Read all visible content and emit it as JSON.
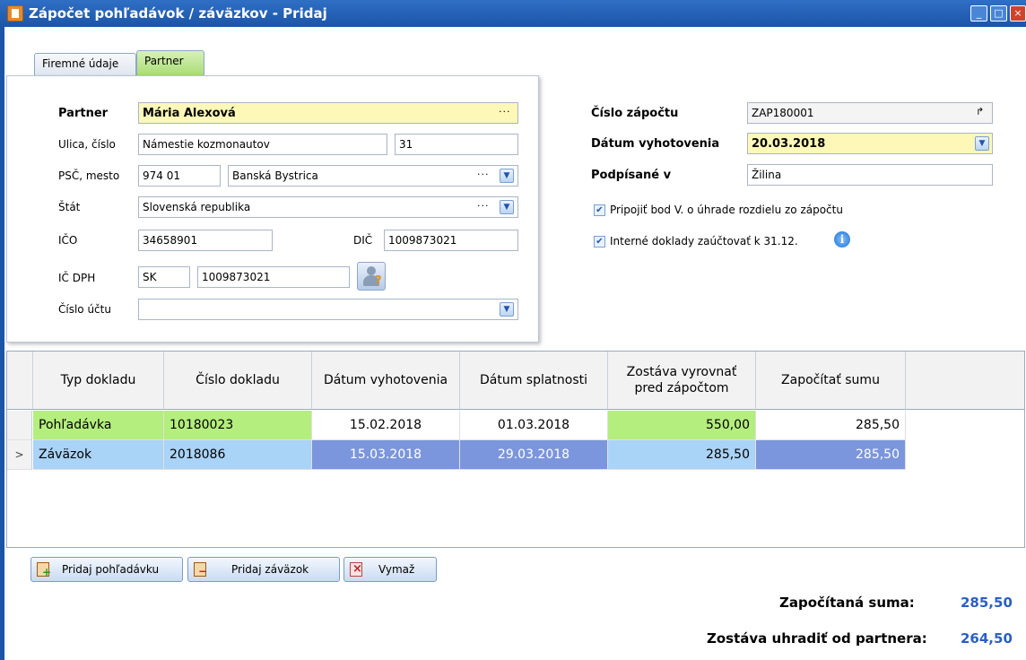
{
  "window": {
    "title": "Zápočet pohľadávok / záväzkov - Pridaj"
  },
  "tabs": [
    {
      "label": "Firemné údaje"
    },
    {
      "label": "Partner"
    }
  ],
  "partner": {
    "partner_label": "Partner",
    "partner_value": "Mária Alexová",
    "street_label": "Ulica, číslo",
    "street_value": "Námestie kozmonautov",
    "number_value": "31",
    "city_label": "PSČ, mesto",
    "zip_value": "974 01",
    "city_value": "Banská Bystrica",
    "country_label": "Štát",
    "country_value": "Slovenská republika",
    "ico_label": "IČO",
    "ico_value": "34658901",
    "dic_label": "DIČ",
    "dic_value": "1009873021",
    "icdph_label": "IČ DPH",
    "icdph_prefix": "SK",
    "icdph_value": "1009873021",
    "account_label": "Číslo účtu",
    "account_value": ""
  },
  "header_right": {
    "number_label": "Číslo zápočtu",
    "number_value": "ZAP180001",
    "date_label": "Dátum vyhotovenia",
    "date_value": "20.03.2018",
    "signed_label": "Podpísané v",
    "signed_value": "Žilina",
    "check1_label": "Pripojiť bod V. o úhrade rozdielu zo zápočtu",
    "check1_checked": true,
    "check2_label": "Interné doklady zaúčtovať k 31.12.",
    "check2_checked": true
  },
  "grid": {
    "columns": [
      "Typ dokladu",
      "Číslo dokladu",
      "Dátum vyhotovenia",
      "Dátum splatnosti",
      "Zostáva vyrovnať pred zápočtom",
      "Započítať sumu"
    ],
    "rows": [
      {
        "type": "Pohľadávka",
        "number": "10180023",
        "issued": "15.02.2018",
        "due": "01.03.2018",
        "remaining": "550,00",
        "offset": "285,50",
        "indicator": ""
      },
      {
        "type": "Záväzok",
        "number": "2018086",
        "issued": "15.03.2018",
        "due": "29.03.2018",
        "remaining": "285,50",
        "offset": "285,50",
        "indicator": ">"
      }
    ]
  },
  "buttons": {
    "add_receivable": "Pridaj pohľadávku",
    "add_liability": "Pridaj záväzok",
    "delete": "Vymaž"
  },
  "summary": {
    "offset_label": "Započítaná suma:",
    "offset_value": "285,50",
    "remaining_label": "Zostáva uhradiť od partnera:",
    "remaining_value": "264,50"
  }
}
